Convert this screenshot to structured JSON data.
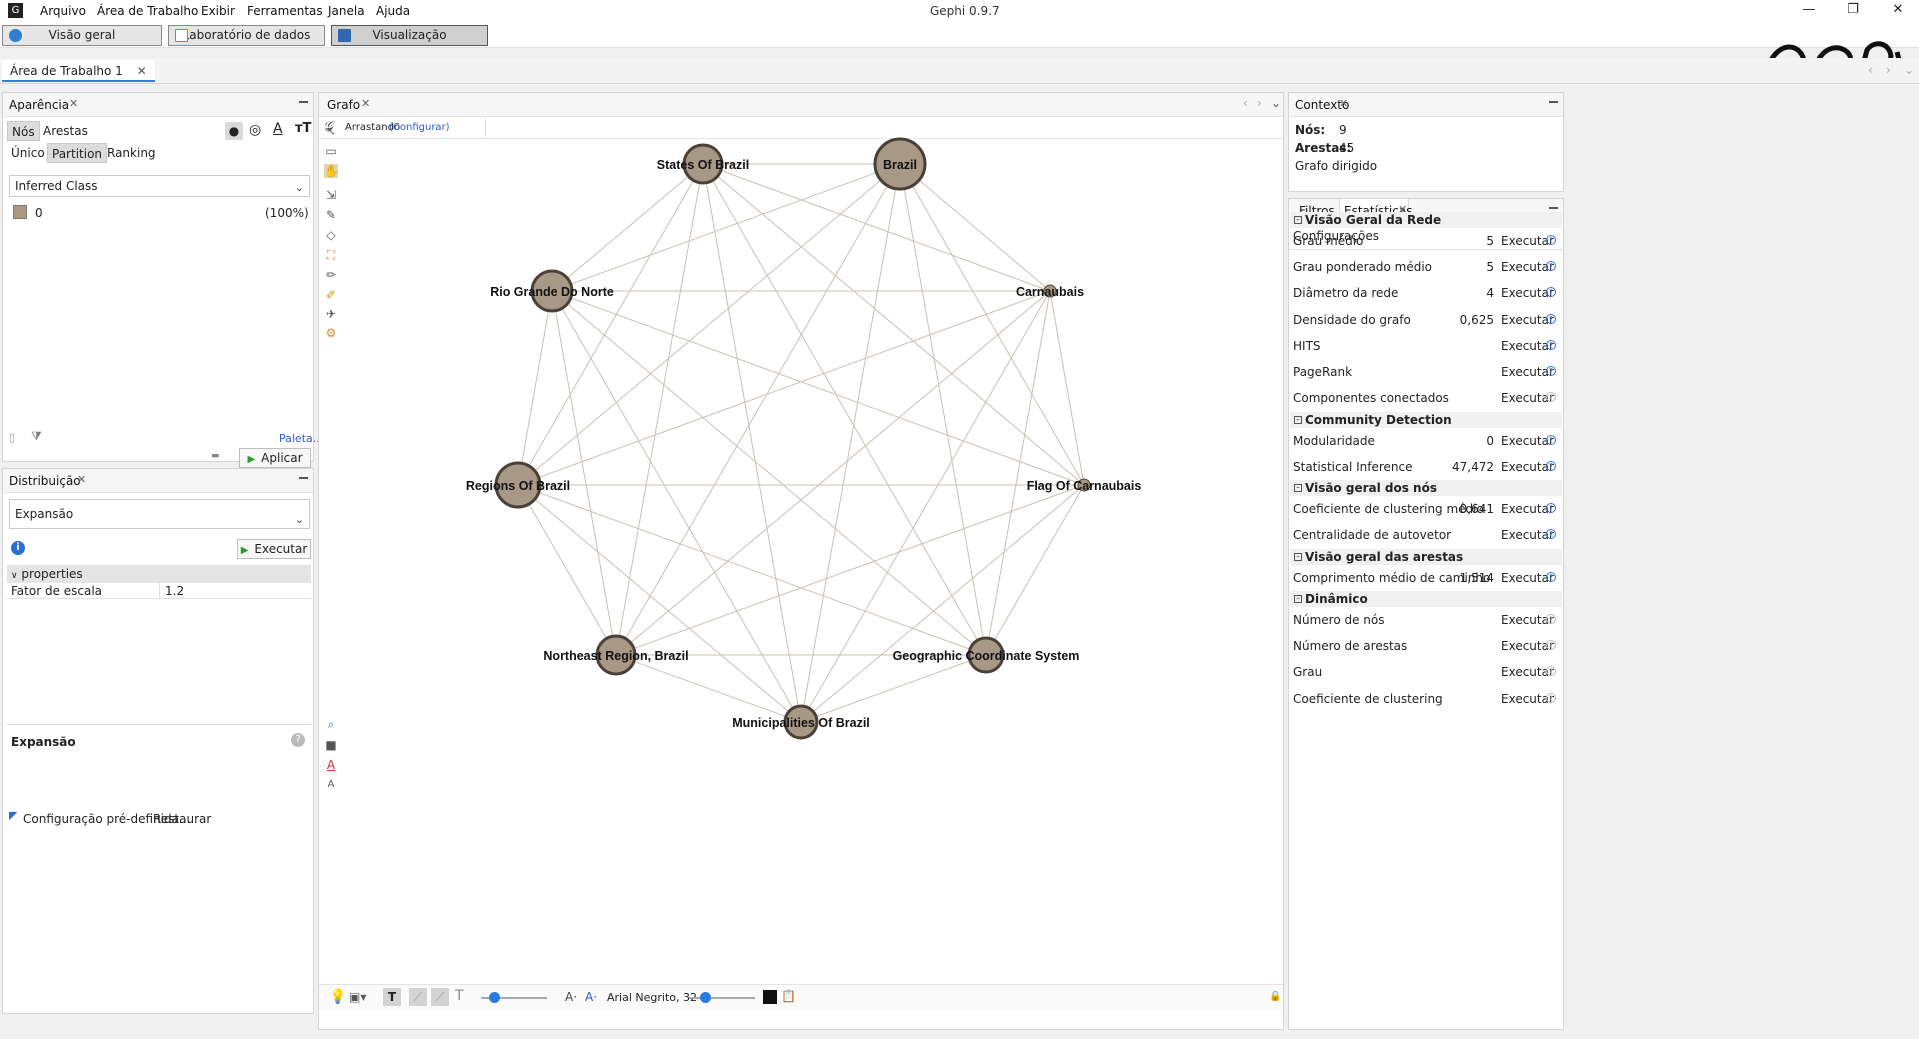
{
  "window": {
    "title": "Gephi 0.9.7"
  },
  "menu": [
    "Arquivo",
    "Área de Trabalho",
    "Exibir",
    "Ferramentas",
    "Janela",
    "Ajuda"
  ],
  "modes": [
    {
      "label": "Visão geral",
      "color": "#2d7fd3"
    },
    {
      "label": "Laboratório de dados",
      "color": "#4a90e2"
    },
    {
      "label": "Visualização",
      "color": "#3366aa"
    }
  ],
  "workspace": {
    "tab": "Área de Trabalho 1"
  },
  "appearance": {
    "title": "Aparência",
    "element_tabs": [
      "Nós",
      "Arestas"
    ],
    "mode_tabs": [
      "Único",
      "Partition",
      "Ranking"
    ],
    "attribute": "Inferred Class",
    "partition_items": [
      {
        "label": "0",
        "percent": "(100%)",
        "color": "#a89987"
      }
    ],
    "palette_link": "Paleta...",
    "apply_label": "Aplicar"
  },
  "layout": {
    "title": "Distribuição",
    "selected": "Expansão",
    "run_label": "Executar",
    "properties_header": "properties",
    "properties": [
      {
        "name": "Fator de escala",
        "value": "1.2"
      }
    ],
    "description_title": "Expansão",
    "preset_label": "Configuração pré-definida...",
    "restore_label": "Restaurar"
  },
  "graph": {
    "title": "Grafo",
    "mode_label": "Arrastando",
    "configure_label": "(Configurar)",
    "font_label": "Arial Negrito, 32",
    "node_color": "#a89987",
    "edge_color": "#c9c0b5",
    "nodes": [
      {
        "id": "states",
        "label": "States Of Brazil"
      },
      {
        "id": "brazil",
        "label": "Brazil"
      },
      {
        "id": "rgdn",
        "label": "Rio Grande Do Norte"
      },
      {
        "id": "carnaubais",
        "label": "Carnaubais"
      },
      {
        "id": "regions",
        "label": "Regions Of Brazil"
      },
      {
        "id": "flag",
        "label": "Flag Of Carnaubais"
      },
      {
        "id": "northeast",
        "label": "Northeast Region, Brazil"
      },
      {
        "id": "geo",
        "label": "Geographic Coordinate System"
      },
      {
        "id": "muni",
        "label": "Municipalities Of Brazil"
      }
    ]
  },
  "context": {
    "title": "Contexto",
    "nodes_label": "Nós:",
    "nodes_value": "9",
    "edges_label": "Arestas:",
    "edges_value": "45",
    "graph_type": "Grafo dirigido"
  },
  "statistics": {
    "tabs": [
      "Filtros",
      "Estatísticas"
    ],
    "settings_label": "Configurações",
    "run_label": "Executar",
    "sections": [
      {
        "title": "Visão Geral da Rede",
        "rows": [
          {
            "label": "Grau médio",
            "value": "5"
          },
          {
            "label": "Grau ponderado médio",
            "value": "5"
          },
          {
            "label": "Diâmetro da rede",
            "value": "4"
          },
          {
            "label": "Densidade do grafo",
            "value": "0,625"
          },
          {
            "label": "HITS",
            "value": ""
          },
          {
            "label": "PageRank",
            "value": ""
          },
          {
            "label": "Componentes conectados",
            "value": ""
          }
        ]
      },
      {
        "title": "Community Detection",
        "rows": [
          {
            "label": "Modularidade",
            "value": "0"
          },
          {
            "label": "Statistical Inference",
            "value": "47,472"
          }
        ]
      },
      {
        "title": "Visão geral dos nós",
        "rows": [
          {
            "label": "Coeficiente de clustering médio",
            "value": "0,641"
          },
          {
            "label": "Centralidade de autovetor",
            "value": ""
          }
        ]
      },
      {
        "title": "Visão geral das arestas",
        "rows": [
          {
            "label": "Comprimento médio de caminho",
            "value": "1,514"
          }
        ]
      },
      {
        "title": "Dinâmico",
        "rows": [
          {
            "label": "Número de nós",
            "value": ""
          },
          {
            "label": "Número de arestas",
            "value": ""
          },
          {
            "label": "Grau",
            "value": ""
          },
          {
            "label": "Coeficiente de clustering",
            "value": ""
          }
        ]
      }
    ]
  }
}
